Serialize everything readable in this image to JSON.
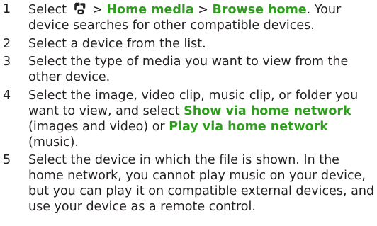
{
  "steps": [
    {
      "number": "1",
      "parts": {
        "t1": "Select",
        "icon": "menu-key-icon",
        "sep1": ">",
        "h1": "Home media",
        "sep2": ">",
        "h2": "Browse home",
        "t2": ". Your device searches for other compatible devices."
      }
    },
    {
      "number": "2",
      "text": "Select a device from the list."
    },
    {
      "number": "3",
      "text": "Select the type of media you want to view from the other device."
    },
    {
      "number": "4",
      "parts": {
        "t1": "Select the image, video clip, music clip, or folder you want to view, and select",
        "h1": "Show via home network",
        "t2": "(images and video) or",
        "h2": "Play via home network",
        "t3": "(music)."
      }
    },
    {
      "number": "5",
      "text": "Select the device in which the file is shown. In the home network, you cannot play music on your device, but you can play it on compatible external devices, and use your device as a remote control."
    }
  ],
  "colors": {
    "text": "#231f20",
    "highlight": "#2f9e1e"
  }
}
